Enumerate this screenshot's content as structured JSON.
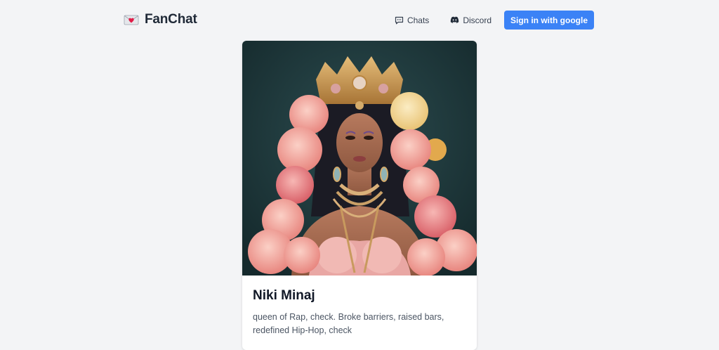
{
  "brand": {
    "name": "FanChat",
    "icon": "heart-envelope-icon"
  },
  "nav": {
    "chats_label": "Chats",
    "chats_icon": "chat-bubble-icon",
    "discord_label": "Discord",
    "discord_icon": "discord-icon",
    "signin_label": "Sign in with google"
  },
  "card": {
    "name": "Niki Minaj",
    "description": "queen of Rap, check. Broke barriers, raised bars, redefined Hip-Hop, check"
  },
  "colors": {
    "background": "#f3f4f6",
    "accent": "#3b82f6",
    "image_bg": "#1f3a3e"
  }
}
